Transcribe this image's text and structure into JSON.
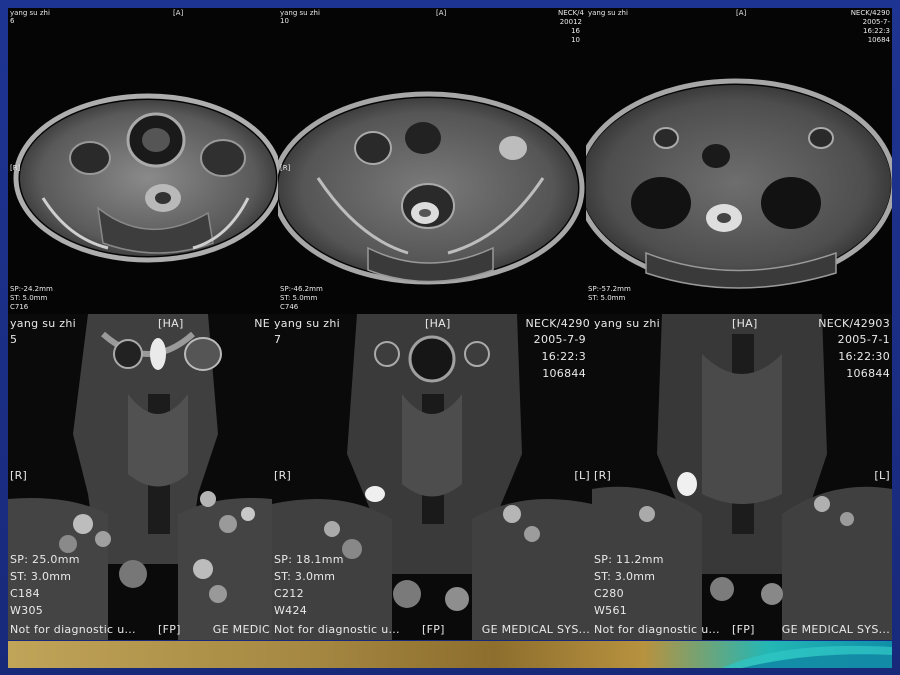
{
  "top_row": [
    {
      "patient": "yang su zhi",
      "image_no": "6",
      "orient_top": "[A]",
      "orient_left": "[R]",
      "study": "",
      "date": "",
      "time": "",
      "id": "",
      "sp": "SP:-24.2mm",
      "st": "ST: 5.0mm",
      "c": "C716"
    },
    {
      "patient": "yang su zhi",
      "image_no": "10",
      "orient_top": "[A]",
      "orient_left": "[R]",
      "study": "NECK/4",
      "date": "20012",
      "time": "16",
      "id": "10",
      "sp": "SP:-46.2mm",
      "st": "ST: 5.0mm",
      "c": "C746"
    },
    {
      "patient": "yang su zhi",
      "image_no": "",
      "orient_top": "[A]",
      "orient_left": "",
      "study": "NECK/4290",
      "date": "2005-7-",
      "time": "16:22:3",
      "id": "10684",
      "sp": "SP:-57.2mm",
      "st": "ST: 5.0mm",
      "c": ""
    }
  ],
  "bottom_row": [
    {
      "patient": "yang su zhi",
      "image_no": "5",
      "orient_top": "[HA]",
      "orient_left": "[R]",
      "orient_right": "",
      "study": "NE",
      "date": "",
      "time": "",
      "id": "",
      "sp": "SP: 25.0mm",
      "st": "ST: 3.0mm",
      "c": "C184",
      "w": "W305",
      "disclaimer": "Not for diagnostic u...",
      "orient_bottom": "[FP]",
      "maker": "GE MEDIC"
    },
    {
      "patient": "yang su zhi",
      "image_no": "7",
      "orient_top": "[HA]",
      "orient_left": "[R]",
      "orient_right": "[L]",
      "study": "NECK/4290",
      "date": "2005-7-9",
      "time": "16:22:3",
      "id": "106844",
      "sp": "SP: 18.1mm",
      "st": "ST: 3.0mm",
      "c": "C212",
      "w": "W424",
      "disclaimer": "Not for diagnostic u...",
      "orient_bottom": "[FP]",
      "maker": "GE MEDICAL SYS..."
    },
    {
      "patient": "yang su zhi",
      "image_no": "",
      "orient_top": "[HA]",
      "orient_left": "[R]",
      "orient_right": "[L]",
      "study": "NECK/42903",
      "date": "2005-7-1",
      "time": "16:22:30",
      "id": "106844",
      "sp": "SP: 11.2mm",
      "st": "ST: 3.0mm",
      "c": "C280",
      "w": "W561",
      "disclaimer": "Not for diagnostic u...",
      "orient_bottom": "[FP]",
      "maker": "GE MEDICAL SYS..."
    }
  ]
}
